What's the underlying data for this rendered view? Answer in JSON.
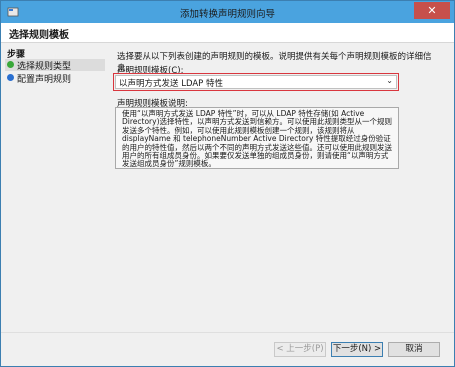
{
  "window": {
    "title": "添加转换声明规则向导",
    "close_glyph": "✕"
  },
  "header": {
    "page_title": "选择规则模板"
  },
  "sidebar": {
    "steps_title": "步骤",
    "items": [
      {
        "label": "选择规则类型",
        "color": "#3aa83a"
      },
      {
        "label": "配置声明规则",
        "color": "#2a6fd0"
      }
    ]
  },
  "main": {
    "intro": "选择要从以下列表创建的声明规则的模板。说明提供有关每个声明规则模板的详细信息。",
    "template_label": "声明规则模板(C):",
    "template_value": "以声明方式发送 LDAP 特性",
    "chevron": "⌄",
    "desc_label": "声明规则模板说明:",
    "desc_p1": "使用“以声明方式发送 LDAP 特性”时，可以从 LDAP 特性存储(如 Active Directory)选择特性，以声明方式发送到信赖方。可以使用此规则类型从一个规则发送多个特性。例如，可以使用此规则模板创建一个规则，该规则将从 displayName 和 telephoneNumber Active Directory 特性提取经过身份验证的用户的特性值，然后以两个不同的声明方式发送这些值。还可以使用此规则发送用户的所有组成员身份。如果要仅发送单独的组成员身份，则请使用“以声明方式发送组成员身份”规则模板。"
  },
  "footer": {
    "prev_label": "< 上一步(P)",
    "next_label": "下一步(N) >",
    "cancel_label": "取消"
  }
}
